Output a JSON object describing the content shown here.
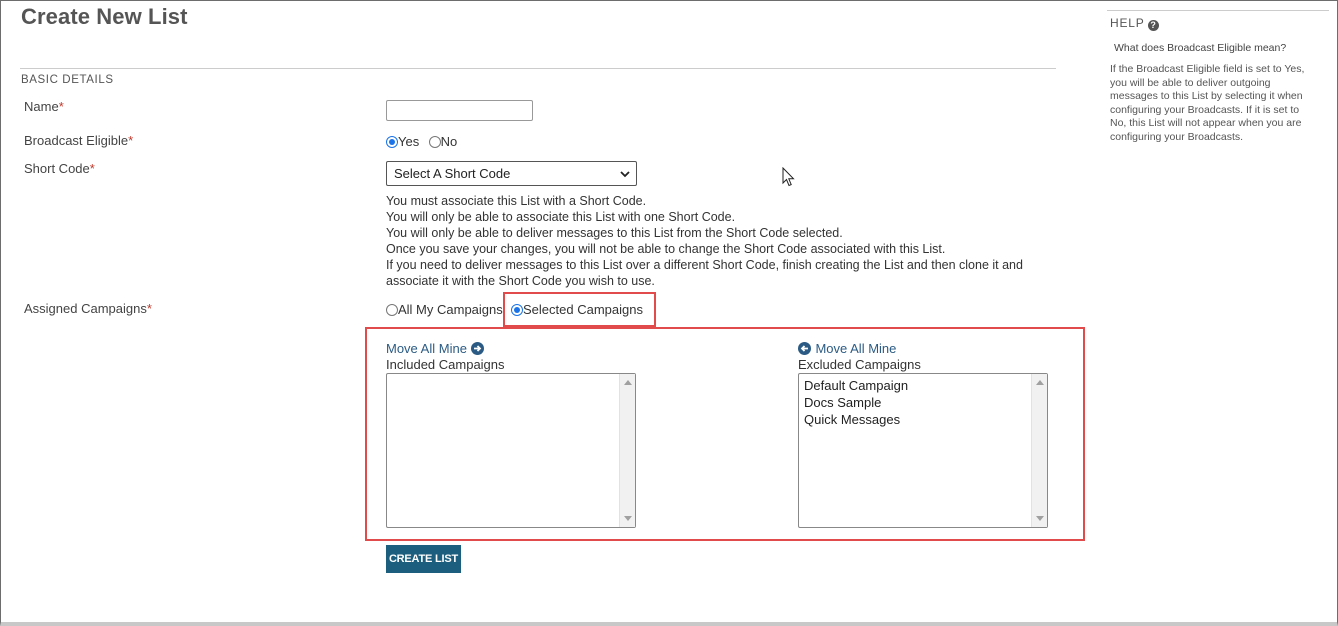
{
  "page": {
    "title": "Create New List",
    "section_label": "BASIC DETAILS"
  },
  "fields": {
    "name_label": "Name",
    "name_value": "",
    "broadcast_label": "Broadcast Eligible",
    "broadcast_yes": "Yes",
    "broadcast_no": "No",
    "broadcast_selected": "Yes",
    "shortcode_label": "Short Code",
    "shortcode_selected": "Select A Short Code",
    "assigned_label": "Assigned Campaigns",
    "assigned_all": "All My Campaigns",
    "assigned_selected_opt": "Selected Campaigns",
    "assigned_selected": "Selected Campaigns",
    "required_mark": "*"
  },
  "shortcode_info": [
    "You must associate this List with a Short Code.",
    "You will only be able to associate this List with one Short Code.",
    "You will only be able to deliver messages to this List from the Short Code selected.",
    "Once you save your changes, you will not be able to change the Short Code associated with this List.",
    "If you need to deliver messages to this List over a different Short Code, finish creating the List and then clone it and",
    "associate it with the Short Code you wish to use."
  ],
  "campaigns": {
    "move_all_right": "Move All Mine",
    "included_label": "Included Campaigns",
    "included_items": [],
    "move_all_left": "Move All Mine",
    "excluded_label": "Excluded Campaigns",
    "excluded_items": [
      "Default Campaign",
      "Docs Sample",
      "Quick Messages"
    ]
  },
  "actions": {
    "create_label": "CREATE LIST"
  },
  "help": {
    "title": "HELP",
    "question": "What does Broadcast Eligible mean?",
    "answer_lines": [
      "If the Broadcast Eligible field is set to Yes,",
      "you will be able to deliver outgoing",
      "messages to this List by selecting it when",
      "configuring your Broadcasts. If it is set to",
      "No, this List will not appear when you are",
      "configuring your Broadcasts."
    ]
  },
  "colors": {
    "accent": "#1c5e7d",
    "link": "#2b5b84",
    "highlight": "#e24b4b",
    "required": "#c0392b"
  },
  "icons": {
    "arrow_right": "arrow-circle-right-icon",
    "arrow_left": "arrow-circle-left-icon",
    "help": "question-circle-icon",
    "chevron": "chevron-down-icon"
  }
}
